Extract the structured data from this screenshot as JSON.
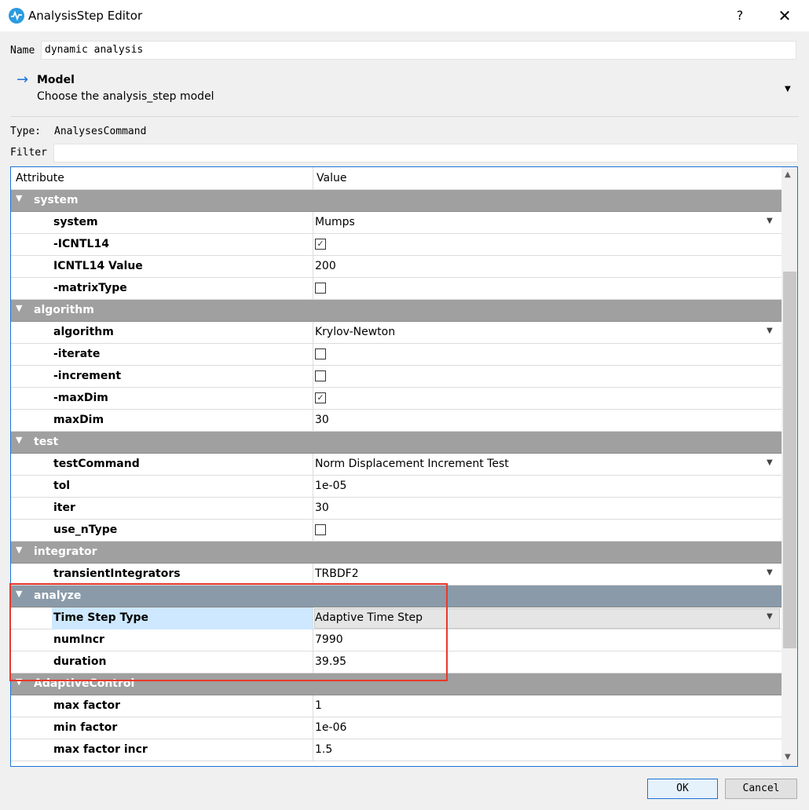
{
  "window": {
    "title": "AnalysisStep Editor",
    "help": "?",
    "close": "✕"
  },
  "name": {
    "label": "Name",
    "value": "dynamic analysis"
  },
  "model": {
    "title": "Model",
    "subtitle": "Choose the analysis_step model"
  },
  "type": {
    "label": "Type:",
    "value": "AnalysesCommand"
  },
  "filter": {
    "label": "Filter",
    "value": ""
  },
  "table": {
    "headers": {
      "attribute": "Attribute",
      "value": "Value"
    },
    "rows": [
      {
        "group": "system"
      },
      {
        "name": "system",
        "value": "Mumps",
        "dropdown": true
      },
      {
        "name": "-ICNTL14",
        "checkbox": true,
        "checked": true
      },
      {
        "name": "ICNTL14 Value",
        "value": "200"
      },
      {
        "name": "-matrixType",
        "checkbox": true,
        "checked": false
      },
      {
        "group": "algorithm"
      },
      {
        "name": "algorithm",
        "value": "Krylov-Newton",
        "dropdown": true
      },
      {
        "name": "-iterate",
        "checkbox": true,
        "checked": false
      },
      {
        "name": "-increment",
        "checkbox": true,
        "checked": false
      },
      {
        "name": "-maxDim",
        "checkbox": true,
        "checked": true
      },
      {
        "name": "maxDim",
        "value": "30"
      },
      {
        "group": "test"
      },
      {
        "name": "testCommand",
        "value": "Norm Displacement Increment Test",
        "dropdown": true
      },
      {
        "name": "tol",
        "value": "1e-05"
      },
      {
        "name": "iter",
        "value": "30"
      },
      {
        "name": "use_nType",
        "checkbox": true,
        "checked": false
      },
      {
        "group": "integrator"
      },
      {
        "name": "transientIntegrators",
        "value": "TRBDF2",
        "dropdown": true
      },
      {
        "group": "analyze",
        "highlight": true
      },
      {
        "name": "Time Step Type",
        "value": "Adaptive Time Step",
        "dropdown": true,
        "selected": true
      },
      {
        "name": "numIncr",
        "value": "7990"
      },
      {
        "name": "duration",
        "value": "39.95"
      },
      {
        "group": "AdaptiveControl"
      },
      {
        "name": "max factor",
        "value": "1"
      },
      {
        "name": "min factor",
        "value": "1e-06"
      },
      {
        "name": "max factor incr",
        "value": "1.5"
      }
    ]
  },
  "buttons": {
    "ok": "OK",
    "cancel": "Cancel"
  },
  "colors": {
    "accent": "#1a73d6",
    "group_bg": "#a0a0a0",
    "highlight_box": "#e8392b"
  }
}
